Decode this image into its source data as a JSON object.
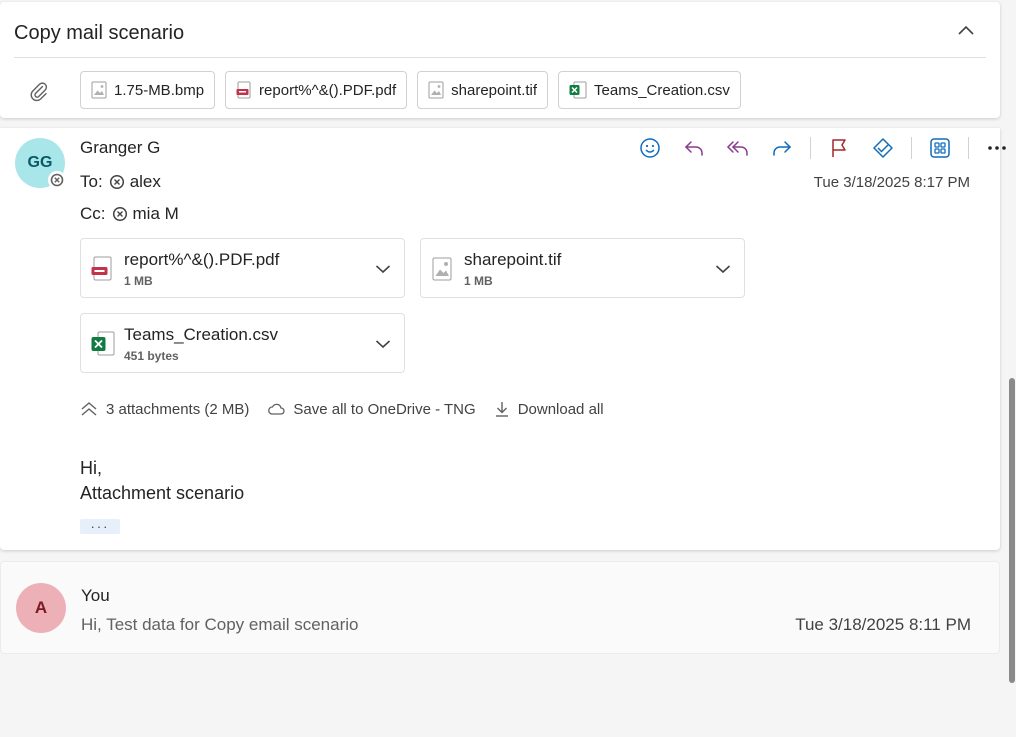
{
  "thread": {
    "subject": "Copy mail scenario",
    "header_attachments": [
      {
        "name": "1.75-MB.bmp",
        "type": "image"
      },
      {
        "name": "report%^&().PDF.pdf",
        "type": "pdf"
      },
      {
        "name": "sharepoint.tif",
        "type": "image"
      },
      {
        "name": "Teams_Creation.csv",
        "type": "excel"
      }
    ]
  },
  "message": {
    "avatar_initials": "GG",
    "sender": "Granger G",
    "to_label": "To:",
    "to_name": "alex",
    "cc_label": "Cc:",
    "cc_name": "mia M",
    "date": "Tue 3/18/2025 8:17 PM",
    "attachments": [
      {
        "name": "report%^&().PDF.pdf",
        "size": "1 MB",
        "type": "pdf"
      },
      {
        "name": "sharepoint.tif",
        "size": "1 MB",
        "type": "image"
      },
      {
        "name": "Teams_Creation.csv",
        "size": "451 bytes",
        "type": "excel"
      }
    ],
    "attachments_summary": "3 attachments (2 MB)",
    "save_all": "Save all to OneDrive - TNG",
    "download_all": "Download all",
    "body_line1": "Hi,",
    "body_line2": "Attachment scenario",
    "more_dots": "···"
  },
  "reply": {
    "avatar_initials": "A",
    "sender": "You",
    "preview": "Hi, Test data for Copy email scenario",
    "date": "Tue 3/18/2025 8:11 PM"
  },
  "colors": {
    "accent_blue": "#0f6cbd",
    "reply_purple": "#8a3a8f",
    "flag_red": "#a4262c",
    "excel_green": "#107c41",
    "pdf_red": "#c4314b"
  }
}
